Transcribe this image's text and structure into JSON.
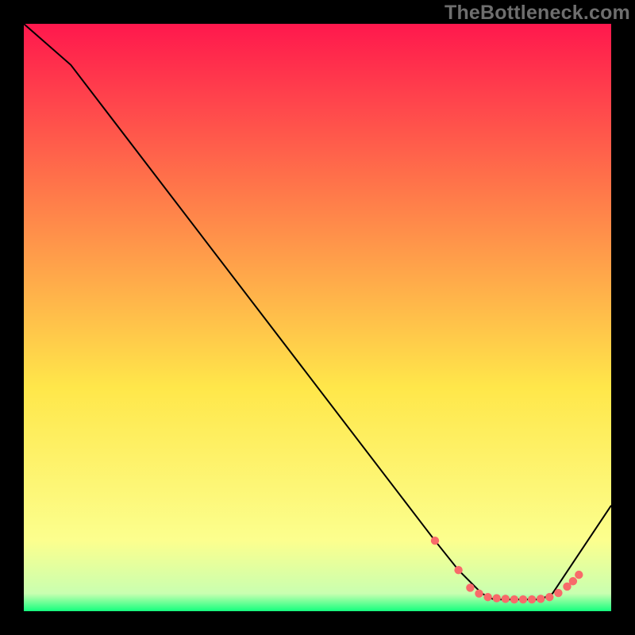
{
  "watermark": "TheBottleneck.com",
  "chart_data": {
    "type": "line",
    "title": "",
    "xlabel": "",
    "ylabel": "",
    "axes_visible": false,
    "xlim": [
      0,
      100
    ],
    "ylim": [
      0,
      100
    ],
    "background_gradient": {
      "top": "#ff184d",
      "mid1": "#ff7d4a",
      "mid2": "#ffe74a",
      "mid3": "#fcff8e",
      "bottom_band": "#15ff7e"
    },
    "series": [
      {
        "name": "bottleneck-curve",
        "color": "#000000",
        "x": [
          0,
          8,
          70,
          74,
          78,
          80,
          82,
          84,
          86,
          88,
          90,
          92,
          100
        ],
        "y": [
          100,
          93,
          12,
          7,
          3,
          2,
          2,
          2,
          2,
          2,
          3,
          6,
          18
        ]
      }
    ],
    "markers": {
      "name": "highlight-dots",
      "color": "#f86a6a",
      "radius": 5.2,
      "x": [
        70,
        74,
        76,
        77.5,
        79,
        80.5,
        82,
        83.5,
        85,
        86.5,
        88,
        89.5,
        91,
        92.5,
        93.5,
        94.5
      ],
      "y": [
        12,
        7,
        4,
        3,
        2.4,
        2.2,
        2.1,
        2.0,
        2.0,
        2.0,
        2.1,
        2.4,
        3.1,
        4.2,
        5.1,
        6.2
      ]
    }
  }
}
